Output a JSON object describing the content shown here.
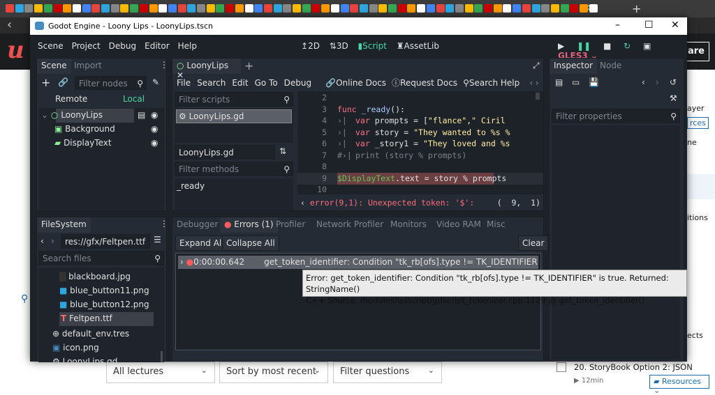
{
  "browser": {
    "new_tab": "+",
    "close_tab": "×",
    "back": "‹"
  },
  "udemy": {
    "share": "are",
    "right_fragments": [
      "ayer",
      "rces",
      "ne",
      "itions",
      "ects"
    ],
    "filters": {
      "lectures": "All lectures",
      "sort": "Sort by most recent",
      "questions": "Filter questions"
    },
    "lecture": {
      "title": "20. StoryBook Option 2: JSON",
      "duration": "12min",
      "resources": "Resources"
    }
  },
  "window": {
    "title": "Godot Engine - Loony Lips - LoonyLips.tscn",
    "minimize": "–",
    "maximize": "☐",
    "close": "✕"
  },
  "menu": [
    "Scene",
    "Project",
    "Debug",
    "Editor",
    "Help"
  ],
  "workspaces": [
    {
      "label": "2D",
      "icon": "2d-icon"
    },
    {
      "label": "3D",
      "icon": "3d-icon"
    },
    {
      "label": "Script",
      "icon": "script-icon",
      "active": true
    },
    {
      "label": "AssetLib",
      "icon": "assetlib-icon"
    }
  ],
  "renderer": "GLES3",
  "accent": "#45d7a4",
  "scene_dock": {
    "tabs": [
      "Scene",
      "Import"
    ],
    "filter_placeholder": "Filter nodes",
    "remote": "Remote",
    "local": "Local",
    "nodes": [
      {
        "name": "LoonyLips",
        "type": "Node"
      },
      {
        "name": "Background",
        "type": "TextureRect"
      },
      {
        "name": "DisplayText",
        "type": "Label"
      }
    ]
  },
  "filesystem": {
    "tab": "FileSystem",
    "path": "res://gfx/Feltpen.ttf",
    "search_placeholder": "Search files",
    "files": [
      "blackboard.jpg",
      "blue_button11.png",
      "blue_button12.png",
      "Feltpen.ttf",
      "default_env.tres",
      "icon.png",
      "LoonyLips.gd"
    ]
  },
  "script_editor": {
    "tab": "LoonyLips",
    "menu": [
      "File",
      "Search",
      "Edit",
      "Go To",
      "Debug"
    ],
    "links": [
      "Online Docs",
      "Request Docs",
      "Search Help"
    ],
    "filter_scripts": "Filter scripts",
    "scripts": [
      "LoonyLips.gd"
    ],
    "current_script": "LoonyLips.gd",
    "filter_methods": "Filter methods",
    "methods": [
      "_ready"
    ],
    "lines": [
      {
        "n": "2",
        "parts": []
      },
      {
        "n": "3",
        "parts": [
          [
            "kw",
            "func "
          ],
          [
            "sym",
            "_ready"
          ],
          [
            "",
            "():"
          ]
        ]
      },
      {
        "n": "4",
        "tab": "›|",
        "parts": [
          [
            "kw",
            "var "
          ],
          [
            "",
            "prompts = ["
          ],
          [
            "str",
            "\"flance\",\" Ciril"
          ]
        ]
      },
      {
        "n": "5",
        "tab": "›|",
        "parts": [
          [
            "kw",
            "var "
          ],
          [
            "",
            "story = "
          ],
          [
            "str",
            "\"They wanted to %s %"
          ]
        ]
      },
      {
        "n": "6",
        "tab": "›|",
        "parts": [
          [
            "kw",
            "var "
          ],
          [
            "",
            "_story1 = "
          ],
          [
            "str",
            "\"They loved and %s"
          ]
        ]
      },
      {
        "n": "7",
        "tab": "#›|",
        "parts": [
          [
            "cm",
            "print (story % prompts)"
          ]
        ]
      },
      {
        "n": "8",
        "parts": []
      },
      {
        "n": "9",
        "parts": [
          [
            "nd",
            "$DisplayText"
          ],
          [
            "",
            ".text = story % prompts"
          ]
        ],
        "error": true
      },
      {
        "n": "10",
        "parts": []
      }
    ],
    "error": "error(9,1): Unexpected token: '$':",
    "cursor": "(  9,  1)"
  },
  "bottom": {
    "tabs": [
      "Debugger",
      "Errors (1)",
      "Profiler",
      "Network Profiler",
      "Monitors",
      "Video RAM",
      "Misc"
    ],
    "expand": "Expand All",
    "collapse": "Collapse All",
    "clear": "Clear",
    "errors": [
      {
        "time": "0:00:00.642",
        "message": "get_token_identifier: Condition \"tk_rb[ofs].type != TK_IDENTIFIER\" is true. Retu"
      }
    ],
    "tooltip": [
      "Error: get_token_identifier: Condition \"tk_rb[ofs].type != TK_IDENTIFIER\" is true. Returned: StringName()",
      "C++ Source: modules/gdscript/gdscript_tokenizer.cpp:1129 @ get_token_identifier()"
    ]
  },
  "inspector": {
    "tabs": [
      "Inspector",
      "Node"
    ],
    "filter_placeholder": "Filter properties"
  }
}
